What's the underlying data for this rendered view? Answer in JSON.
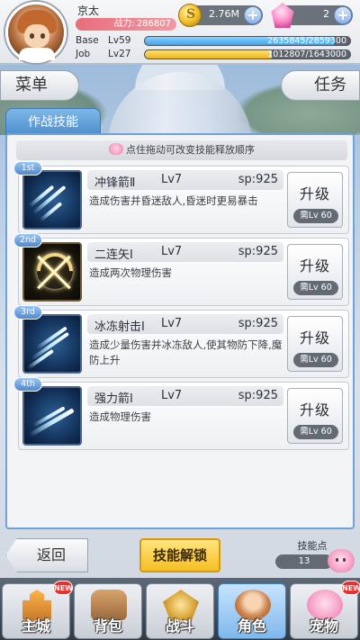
{
  "player": {
    "name": "京太",
    "power_label": "战力:",
    "power": "286807",
    "base_label": "Base",
    "base_level": "Lv59",
    "base_exp": "2635845/2859300",
    "base_exp_progress": 0.9218,
    "job_label": "Job",
    "job_level": "Lv27",
    "job_exp": "1012807/1643000",
    "job_exp_progress": 0.6164
  },
  "currency": {
    "gold": "2.76M",
    "gems": "2"
  },
  "nav_tabs": {
    "menu": "菜单",
    "quest": "任务"
  },
  "section_tab": "作战技能",
  "hint": "点住拖动可改变技能释放顺序",
  "skills": [
    {
      "rank": "1st",
      "name": "冲锋箭Ⅱ",
      "level": "Lv7",
      "sp": "sp:925",
      "desc": "造成伤害并昏迷敌人,昏迷时更易暴击",
      "upgrade": "升级",
      "req": "需Lv 60",
      "icon": "charge-arrow-icon"
    },
    {
      "rank": "2nd",
      "name": "二连矢Ⅰ",
      "level": "Lv7",
      "sp": "sp:925",
      "desc": "造成两次物理伤害",
      "upgrade": "升级",
      "req": "需Lv 60",
      "icon": "double-shot-icon"
    },
    {
      "rank": "3rd",
      "name": "冰冻射击Ⅰ",
      "level": "Lv7",
      "sp": "sp:925",
      "desc": "造成少量伤害并冰冻敌人,使其物防下降,魔防上升",
      "upgrade": "升级",
      "req": "需Lv 60",
      "icon": "freezing-shot-icon"
    },
    {
      "rank": "4th",
      "name": "强力箭Ⅰ",
      "level": "Lv7",
      "sp": "sp:925",
      "desc": "造成物理伤害",
      "upgrade": "升级",
      "req": "需Lv 60",
      "icon": "power-arrow-icon"
    }
  ],
  "bottom_actions": {
    "back": "返回",
    "unlock": "技能解锁",
    "skill_points_label": "技能点",
    "skill_points": "13"
  },
  "bottom_nav": [
    {
      "label": "主城",
      "icon": "castle-icon",
      "badge": "NEW"
    },
    {
      "label": "背包",
      "icon": "backpack-icon",
      "badge": ""
    },
    {
      "label": "战斗",
      "icon": "battle-icon",
      "badge": ""
    },
    {
      "label": "角色",
      "icon": "character-icon",
      "badge": ""
    },
    {
      "label": "宠物",
      "icon": "pet-icon",
      "badge": "NEW"
    }
  ],
  "colors": {
    "accent_blue": "#4e8fcf",
    "unlock_yellow": "#f6bf22",
    "power_pink": "#e86e7b",
    "exp_blue": "#3ea5ee",
    "job_gold": "#eab51d"
  }
}
